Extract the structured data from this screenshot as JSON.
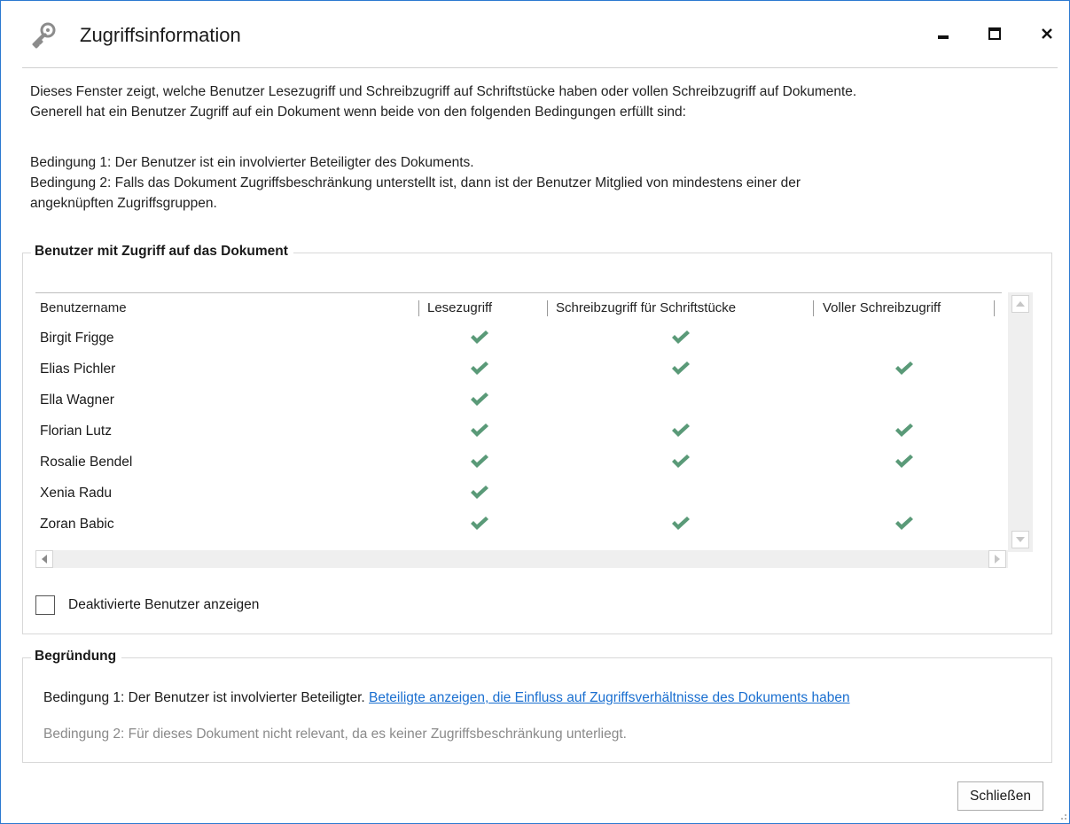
{
  "window": {
    "title": "Zugriffsinformation",
    "accent_color": "#2b79d0"
  },
  "icons": {
    "title": "key-icon",
    "minimize": "minimize-icon",
    "maximize": "maximize-icon",
    "close": "close-icon",
    "check": "checkmark-icon"
  },
  "description": {
    "line1": "Dieses Fenster zeigt, welche Benutzer Lesezugriff und Schreibzugriff auf Schriftstücke haben oder vollen Schreibzugriff auf Dokumente.",
    "line2": "Generell hat ein Benutzer Zugriff auf ein Dokument wenn beide von den folgenden Bedingungen erfüllt sind:",
    "line3": "Bedingung 1: Der Benutzer ist ein involvierter Beteiligter des Dokuments.",
    "line4": "Bedingung 2: Falls das Dokument Zugriffsbeschränkung unterstellt ist, dann ist der Benutzer Mitglied von mindestens einer der",
    "line5": "angeknüpften Zugriffsgruppen."
  },
  "users_group": {
    "title": "Benutzer mit Zugriff auf das Dokument",
    "columns": [
      "Benutzername",
      "Lesezugriff",
      "Schreibzugriff für Schriftstücke",
      "Voller Schreibzugriff"
    ],
    "rows": [
      {
        "name": "Birgit Frigge",
        "read": true,
        "write_docs": true,
        "full_write": false
      },
      {
        "name": "Elias Pichler",
        "read": true,
        "write_docs": true,
        "full_write": true
      },
      {
        "name": "Ella Wagner",
        "read": true,
        "write_docs": false,
        "full_write": false
      },
      {
        "name": "Florian Lutz",
        "read": true,
        "write_docs": true,
        "full_write": true
      },
      {
        "name": "Rosalie Bendel",
        "read": true,
        "write_docs": true,
        "full_write": true
      },
      {
        "name": "Xenia Radu",
        "read": true,
        "write_docs": false,
        "full_write": false
      },
      {
        "name": "Zoran Babic",
        "read": true,
        "write_docs": true,
        "full_write": true
      }
    ],
    "check_color": "#5a9a78",
    "show_disabled_label": "Deaktivierte Benutzer anzeigen",
    "show_disabled_checked": false
  },
  "reason_group": {
    "title": "Begründung",
    "cond1_text": "Bedingung 1: Der Benutzer ist involvierter Beteiligter.",
    "cond1_link": "Beteiligte anzeigen, die Einfluss auf Zugriffsverhältnisse des Dokuments haben",
    "cond2_text": "Bedingung 2: Für dieses Dokument nicht relevant, da es keiner Zugriffsbeschränkung unterliegt."
  },
  "footer": {
    "close_label": "Schließen"
  }
}
